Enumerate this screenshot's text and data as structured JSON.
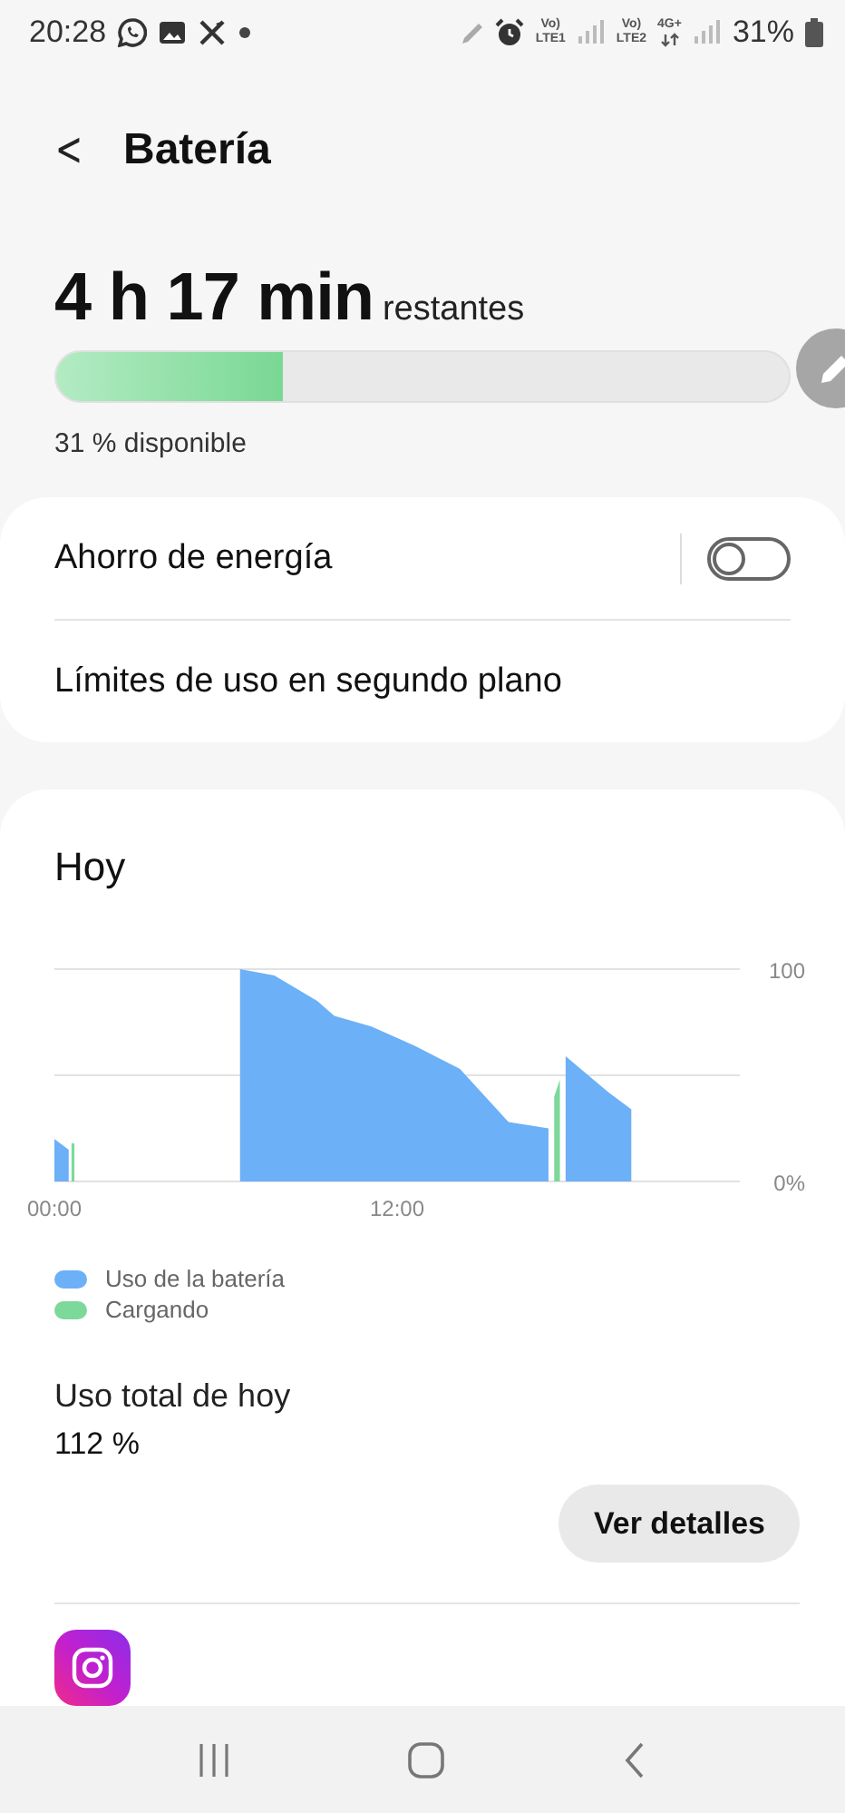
{
  "status_bar": {
    "time": "20:28",
    "sim1_top": "Vo)",
    "sim1_bottom": "LTE1",
    "sim2_top": "Vo)",
    "sim2_bottom": "LTE2",
    "network": "4G+",
    "battery": "31%"
  },
  "header": {
    "back": "<",
    "title": "Batería"
  },
  "summary": {
    "time_left": "4 h 17 min",
    "time_suffix": "restantes",
    "level": 0.31,
    "available": "31 % disponible"
  },
  "settings": [
    {
      "label": "Ahorro de energía",
      "kind": "toggle",
      "on": false
    },
    {
      "label": "Límites de uso en segundo plano",
      "kind": "link"
    }
  ],
  "usage": {
    "title": "Hoy",
    "chart_data": {
      "type": "area",
      "x": [
        0,
        0.5,
        0.6,
        0.7,
        6.5,
        7.7,
        9.2,
        9.8,
        11.1,
        12.6,
        14.2,
        15.9,
        17.3,
        17.5,
        17.7,
        17.9,
        19.4,
        20.2
      ],
      "series": [
        {
          "name": "Uso de la batería",
          "color": "#6cb0f7",
          "values": [
            20,
            15,
            null,
            null,
            100,
            97,
            85,
            78,
            73,
            64,
            53,
            28,
            25,
            null,
            null,
            59,
            42,
            34
          ]
        },
        {
          "name": "Cargando",
          "color": "#7dd99a",
          "values": [
            null,
            null,
            18,
            18,
            null,
            null,
            null,
            null,
            null,
            null,
            null,
            null,
            null,
            40,
            48,
            null,
            null,
            null
          ]
        }
      ],
      "xlim": [
        0,
        24
      ],
      "ylim": [
        0,
        100
      ],
      "ref_lines": [
        {
          "axis": "y",
          "value": 50
        }
      ],
      "xticks": [
        {
          "value": 0,
          "label": "00:00"
        },
        {
          "value": 12,
          "label": "12:00"
        }
      ],
      "yticks": [
        {
          "value": 0,
          "label": "0%"
        },
        {
          "value": 100,
          "label": "100"
        }
      ]
    },
    "total_label": "Uso total de hoy",
    "total_value": "112 %",
    "details_button": "Ver detalles"
  }
}
